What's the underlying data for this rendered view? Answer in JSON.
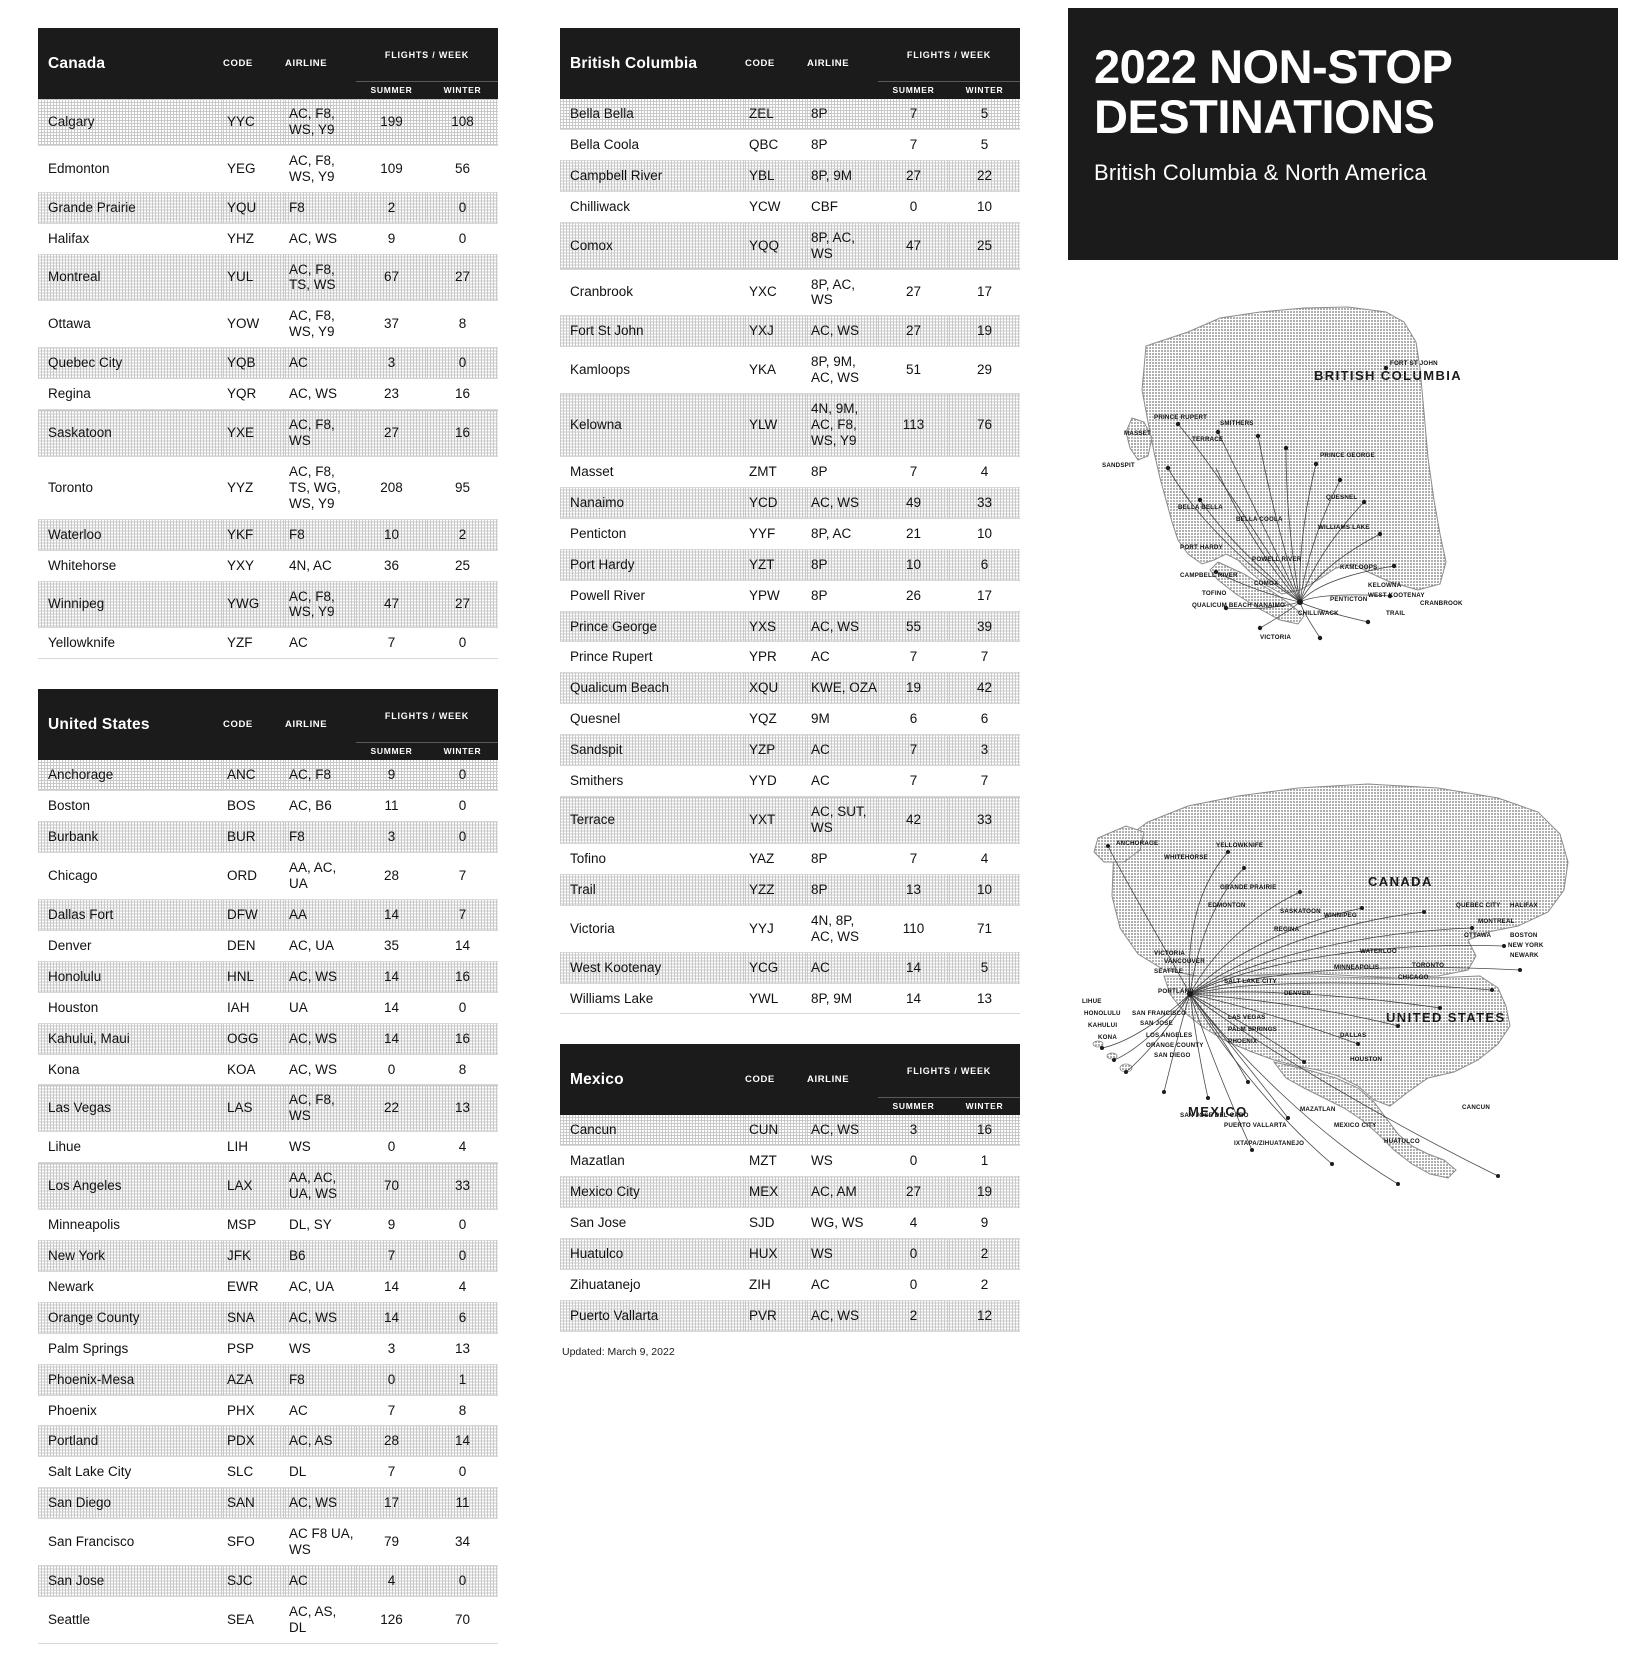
{
  "hero": {
    "title_line1": "2022 NON-STOP",
    "title_line2": "DESTINATIONS",
    "subtitle": "British Columbia & North America"
  },
  "columns": {
    "code": "CODE",
    "airline": "AIRLINE",
    "flights_per_week": "FLIGHTS / WEEK",
    "summer": "SUMMER",
    "winter": "WINTER"
  },
  "footer": {
    "updated": "Updated: March 9, 2022"
  },
  "tables": [
    {
      "region": "Canada",
      "rows": [
        {
          "city": "Calgary",
          "code": "YYC",
          "airlines": "AC, F8, WS, Y9",
          "summer": "199",
          "winter": "108"
        },
        {
          "city": "Edmonton",
          "code": "YEG",
          "airlines": "AC, F8, WS, Y9",
          "summer": "109",
          "winter": "56"
        },
        {
          "city": "Grande Prairie",
          "code": "YQU",
          "airlines": "F8",
          "summer": "2",
          "winter": "0"
        },
        {
          "city": "Halifax",
          "code": "YHZ",
          "airlines": "AC, WS",
          "summer": "9",
          "winter": "0"
        },
        {
          "city": "Montreal",
          "code": "YUL",
          "airlines": "AC, F8, TS, WS",
          "summer": "67",
          "winter": "27"
        },
        {
          "city": "Ottawa",
          "code": "YOW",
          "airlines": "AC, F8, WS, Y9",
          "summer": "37",
          "winter": "8"
        },
        {
          "city": "Quebec City",
          "code": "YQB",
          "airlines": "AC",
          "summer": "3",
          "winter": "0"
        },
        {
          "city": "Regina",
          "code": "YQR",
          "airlines": "AC, WS",
          "summer": "23",
          "winter": "16"
        },
        {
          "city": "Saskatoon",
          "code": "YXE",
          "airlines": "AC, F8, WS",
          "summer": "27",
          "winter": "16"
        },
        {
          "city": "Toronto",
          "code": "YYZ",
          "airlines": "AC, F8, TS, WG, WS, Y9",
          "summer": "208",
          "winter": "95"
        },
        {
          "city": "Waterloo",
          "code": "YKF",
          "airlines": "F8",
          "summer": "10",
          "winter": "2"
        },
        {
          "city": "Whitehorse",
          "code": "YXY",
          "airlines": "4N, AC",
          "summer": "36",
          "winter": "25"
        },
        {
          "city": "Winnipeg",
          "code": "YWG",
          "airlines": "AC, F8, WS, Y9",
          "summer": "47",
          "winter": "27"
        },
        {
          "city": "Yellowknife",
          "code": "YZF",
          "airlines": "AC",
          "summer": "7",
          "winter": "0"
        }
      ]
    },
    {
      "region": "United States",
      "rows": [
        {
          "city": "Anchorage",
          "code": "ANC",
          "airlines": "AC, F8",
          "summer": "9",
          "winter": "0"
        },
        {
          "city": "Boston",
          "code": "BOS",
          "airlines": "AC, B6",
          "summer": "11",
          "winter": "0"
        },
        {
          "city": "Burbank",
          "code": "BUR",
          "airlines": "F8",
          "summer": "3",
          "winter": "0"
        },
        {
          "city": "Chicago",
          "code": "ORD",
          "airlines": "AA, AC, UA",
          "summer": "28",
          "winter": "7"
        },
        {
          "city": "Dallas Fort",
          "code": "DFW",
          "airlines": "AA",
          "summer": "14",
          "winter": "7"
        },
        {
          "city": "Denver",
          "code": "DEN",
          "airlines": "AC, UA",
          "summer": "35",
          "winter": "14"
        },
        {
          "city": "Honolulu",
          "code": "HNL",
          "airlines": "AC, WS",
          "summer": "14",
          "winter": "16"
        },
        {
          "city": "Houston",
          "code": "IAH",
          "airlines": "UA",
          "summer": "14",
          "winter": "0"
        },
        {
          "city": "Kahului, Maui",
          "code": "OGG",
          "airlines": "AC, WS",
          "summer": "14",
          "winter": "16"
        },
        {
          "city": "Kona",
          "code": "KOA",
          "airlines": "AC, WS",
          "summer": "0",
          "winter": "8"
        },
        {
          "city": "Las Vegas",
          "code": "LAS",
          "airlines": "AC, F8, WS",
          "summer": "22",
          "winter": "13"
        },
        {
          "city": "Lihue",
          "code": "LIH",
          "airlines": "WS",
          "summer": "0",
          "winter": "4"
        },
        {
          "city": "Los Angeles",
          "code": "LAX",
          "airlines": "AA, AC, UA, WS",
          "summer": "70",
          "winter": "33"
        },
        {
          "city": "Minneapolis",
          "code": "MSP",
          "airlines": "DL, SY",
          "summer": "9",
          "winter": "0"
        },
        {
          "city": "New York",
          "code": "JFK",
          "airlines": "B6",
          "summer": "7",
          "winter": "0"
        },
        {
          "city": "Newark",
          "code": "EWR",
          "airlines": "AC, UA",
          "summer": "14",
          "winter": "4"
        },
        {
          "city": "Orange County",
          "code": "SNA",
          "airlines": "AC, WS",
          "summer": "14",
          "winter": "6"
        },
        {
          "city": "Palm Springs",
          "code": "PSP",
          "airlines": "WS",
          "summer": "3",
          "winter": "13"
        },
        {
          "city": "Phoenix-Mesa",
          "code": "AZA",
          "airlines": "F8",
          "summer": "0",
          "winter": "1"
        },
        {
          "city": "Phoenix",
          "code": "PHX",
          "airlines": "AC",
          "summer": "7",
          "winter": "8"
        },
        {
          "city": "Portland",
          "code": "PDX",
          "airlines": "AC, AS",
          "summer": "28",
          "winter": "14"
        },
        {
          "city": "Salt Lake City",
          "code": "SLC",
          "airlines": "DL",
          "summer": "7",
          "winter": "0"
        },
        {
          "city": "San Diego",
          "code": "SAN",
          "airlines": "AC, WS",
          "summer": "17",
          "winter": "11"
        },
        {
          "city": "San Francisco",
          "code": "SFO",
          "airlines": "AC F8 UA, WS",
          "summer": "79",
          "winter": "34"
        },
        {
          "city": "San Jose",
          "code": "SJC",
          "airlines": "AC",
          "summer": "4",
          "winter": "0"
        },
        {
          "city": "Seattle",
          "code": "SEA",
          "airlines": "AC, AS, DL",
          "summer": "126",
          "winter": "70"
        }
      ]
    },
    {
      "region": "British Columbia",
      "rows": [
        {
          "city": "Bella Bella",
          "code": "ZEL",
          "airlines": "8P",
          "summer": "7",
          "winter": "5"
        },
        {
          "city": "Bella Coola",
          "code": "QBC",
          "airlines": "8P",
          "summer": "7",
          "winter": "5"
        },
        {
          "city": "Campbell River",
          "code": "YBL",
          "airlines": "8P, 9M",
          "summer": "27",
          "winter": "22"
        },
        {
          "city": "Chilliwack",
          "code": "YCW",
          "airlines": "CBF",
          "summer": "0",
          "winter": "10"
        },
        {
          "city": "Comox",
          "code": "YQQ",
          "airlines": "8P, AC, WS",
          "summer": "47",
          "winter": "25"
        },
        {
          "city": "Cranbrook",
          "code": "YXC",
          "airlines": "8P, AC, WS",
          "summer": "27",
          "winter": "17"
        },
        {
          "city": "Fort St John",
          "code": "YXJ",
          "airlines": "AC, WS",
          "summer": "27",
          "winter": "19"
        },
        {
          "city": "Kamloops",
          "code": "YKA",
          "airlines": "8P, 9M, AC, WS",
          "summer": "51",
          "winter": "29"
        },
        {
          "city": "Kelowna",
          "code": "YLW",
          "airlines": "4N, 9M, AC, F8, WS, Y9",
          "summer": "113",
          "winter": "76"
        },
        {
          "city": "Masset",
          "code": "ZMT",
          "airlines": "8P",
          "summer": "7",
          "winter": "4"
        },
        {
          "city": "Nanaimo",
          "code": "YCD",
          "airlines": "AC, WS",
          "summer": "49",
          "winter": "33"
        },
        {
          "city": "Penticton",
          "code": "YYF",
          "airlines": "8P, AC",
          "summer": "21",
          "winter": "10"
        },
        {
          "city": "Port Hardy",
          "code": "YZT",
          "airlines": "8P",
          "summer": "10",
          "winter": "6"
        },
        {
          "city": "Powell River",
          "code": "YPW",
          "airlines": "8P",
          "summer": "26",
          "winter": "17"
        },
        {
          "city": "Prince George",
          "code": "YXS",
          "airlines": "AC, WS",
          "summer": "55",
          "winter": "39"
        },
        {
          "city": "Prince Rupert",
          "code": "YPR",
          "airlines": "AC",
          "summer": "7",
          "winter": "7"
        },
        {
          "city": "Qualicum Beach",
          "code": "XQU",
          "airlines": "KWE, OZA",
          "summer": "19",
          "winter": "42"
        },
        {
          "city": "Quesnel",
          "code": "YQZ",
          "airlines": "9M",
          "summer": "6",
          "winter": "6"
        },
        {
          "city": "Sandspit",
          "code": "YZP",
          "airlines": "AC",
          "summer": "7",
          "winter": "3"
        },
        {
          "city": "Smithers",
          "code": "YYD",
          "airlines": "AC",
          "summer": "7",
          "winter": "7"
        },
        {
          "city": "Terrace",
          "code": "YXT",
          "airlines": "AC, SUT, WS",
          "summer": "42",
          "winter": "33"
        },
        {
          "city": "Tofino",
          "code": "YAZ",
          "airlines": "8P",
          "summer": "7",
          "winter": "4"
        },
        {
          "city": "Trail",
          "code": "YZZ",
          "airlines": "8P",
          "summer": "13",
          "winter": "10"
        },
        {
          "city": "Victoria",
          "code": "YYJ",
          "airlines": "4N, 8P, AC, WS",
          "summer": "110",
          "winter": "71"
        },
        {
          "city": "West Kootenay",
          "code": "YCG",
          "airlines": "AC",
          "summer": "14",
          "winter": "5"
        },
        {
          "city": "Williams Lake",
          "code": "YWL",
          "airlines": "8P, 9M",
          "summer": "14",
          "winter": "13"
        }
      ]
    },
    {
      "region": "Mexico",
      "rows": [
        {
          "city": "Cancun",
          "code": "CUN",
          "airlines": "AC, WS",
          "summer": "3",
          "winter": "16"
        },
        {
          "city": "Mazatlan",
          "code": "MZT",
          "airlines": "WS",
          "summer": "0",
          "winter": "1"
        },
        {
          "city": "Mexico City",
          "code": "MEX",
          "airlines": "AC, AM",
          "summer": "27",
          "winter": "19"
        },
        {
          "city": "San Jose",
          "code": "SJD",
          "airlines": "WG, WS",
          "summer": "4",
          "winter": "9"
        },
        {
          "city": "Huatulco",
          "code": "HUX",
          "airlines": "WS",
          "summer": "0",
          "winter": "2"
        },
        {
          "city": "Zihuatanejo",
          "code": "ZIH",
          "airlines": "AC",
          "summer": "0",
          "winter": "2"
        },
        {
          "city": "Puerto Vallarta",
          "code": "PVR",
          "airlines": "AC, WS",
          "summer": "2",
          "winter": "12"
        }
      ]
    }
  ],
  "maps": {
    "bc": {
      "region_label": "BRITISH COLUMBIA",
      "cities": [
        "FORT ST JOHN",
        "PRINCE RUPERT",
        "SMITHERS",
        "TERRACE",
        "MASSET",
        "SANDSPIT",
        "PRINCE GEORGE",
        "QUESNEL",
        "WILLIAMS LAKE",
        "BELLA BELLA",
        "BELLA COOLA",
        "PORT HARDY",
        "POWELL RIVER",
        "CAMPBELL RIVER",
        "COMOX",
        "TOFINO",
        "QUALICUM BEACH",
        "NANAIMO",
        "KAMLOOPS",
        "KELOWNA",
        "WEST KOOTENAY",
        "PENTICTON",
        "CRANBROOK",
        "TRAIL",
        "CHILLIWACK",
        "VICTORIA"
      ]
    },
    "na": {
      "region_labels": [
        "CANADA",
        "UNITED STATES",
        "MEXICO"
      ],
      "cities": [
        "ANCHORAGE",
        "YELLOWKNIFE",
        "WHITEHORSE",
        "GRANDE PRAIRIE",
        "EDMONTON",
        "SASKATOON",
        "REGINA",
        "WINNIPEG",
        "QUEBEC CITY",
        "HALIFAX",
        "MONTREAL",
        "OTTAWA",
        "TORONTO",
        "WATERLOO",
        "BOSTON",
        "NEW YORK",
        "NEWARK",
        "CHICAGO",
        "VICTORIA",
        "VANCOUVER",
        "SEATTLE",
        "PORTLAND",
        "SALT LAKE CITY",
        "DENVER",
        "MINNEAPOLIS",
        "LIHUE",
        "HONOLULU",
        "KAHULUI",
        "KONA",
        "SAN FRANCISCO",
        "SAN JOSE",
        "LAS VEGAS",
        "PALM SPRINGS",
        "PHOENIX",
        "LOS ANGELES",
        "ORANGE COUNTY",
        "SAN DIEGO",
        "DALLAS",
        "HOUSTON",
        "CANCUN",
        "MAZATLAN",
        "MEXICO CITY",
        "HUATULCO",
        "PUERTO VALLARTA",
        "SAN JOSE DEL CABO",
        "IXTAPA/ZIHUATANEJO"
      ]
    }
  }
}
